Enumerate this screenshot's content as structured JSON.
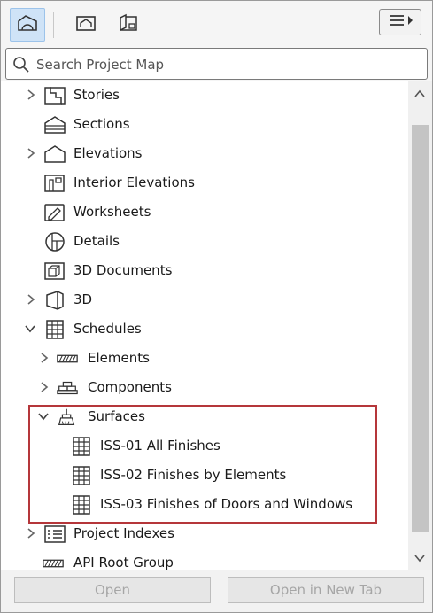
{
  "toolbar": {
    "buttons": [
      {
        "icon": "project-map-icon",
        "active": true
      },
      {
        "icon": "view-map-icon",
        "active": false
      },
      {
        "icon": "layout-book-icon",
        "active": false
      }
    ],
    "menu_icon": "menu-options-icon"
  },
  "search": {
    "placeholder": "Search Project Map",
    "value": ""
  },
  "tree": {
    "items": [
      {
        "label": "Stories",
        "icon": "stories-icon",
        "expander": "collapsed"
      },
      {
        "label": "Sections",
        "icon": "sections-icon",
        "expander": "none"
      },
      {
        "label": "Elevations",
        "icon": "elevations-icon",
        "expander": "collapsed"
      },
      {
        "label": "Interior Elevations",
        "icon": "interior-elevations-icon",
        "expander": "none"
      },
      {
        "label": "Worksheets",
        "icon": "worksheets-icon",
        "expander": "none"
      },
      {
        "label": "Details",
        "icon": "details-icon",
        "expander": "none"
      },
      {
        "label": "3D Documents",
        "icon": "3d-documents-icon",
        "expander": "none"
      },
      {
        "label": "3D",
        "icon": "3d-icon",
        "expander": "collapsed"
      },
      {
        "label": "Schedules",
        "icon": "schedule-grid-icon",
        "expander": "expanded"
      },
      {
        "label": "Elements",
        "icon": "elements-hatch-icon",
        "expander": "collapsed"
      },
      {
        "label": "Components",
        "icon": "components-icon",
        "expander": "collapsed"
      },
      {
        "label": "Surfaces",
        "icon": "surfaces-brush-icon",
        "expander": "expanded"
      },
      {
        "label": "ISS-01 All Finishes",
        "icon": "schedule-grid-icon",
        "expander": "none"
      },
      {
        "label": "ISS-02 Finishes by Elements",
        "icon": "schedule-grid-icon",
        "expander": "none"
      },
      {
        "label": "ISS-03 Finishes of Doors and Windows",
        "icon": "schedule-grid-icon",
        "expander": "none"
      },
      {
        "label": "Project Indexes",
        "icon": "project-indexes-icon",
        "expander": "collapsed"
      },
      {
        "label": "API Root Group",
        "icon": "elements-hatch-icon",
        "expander": "none"
      }
    ]
  },
  "buttons": {
    "open": "Open",
    "open_new_tab": "Open in New Tab"
  },
  "colors": {
    "highlight_border": "#b5363a",
    "active_tab": "#cfe3f7"
  }
}
